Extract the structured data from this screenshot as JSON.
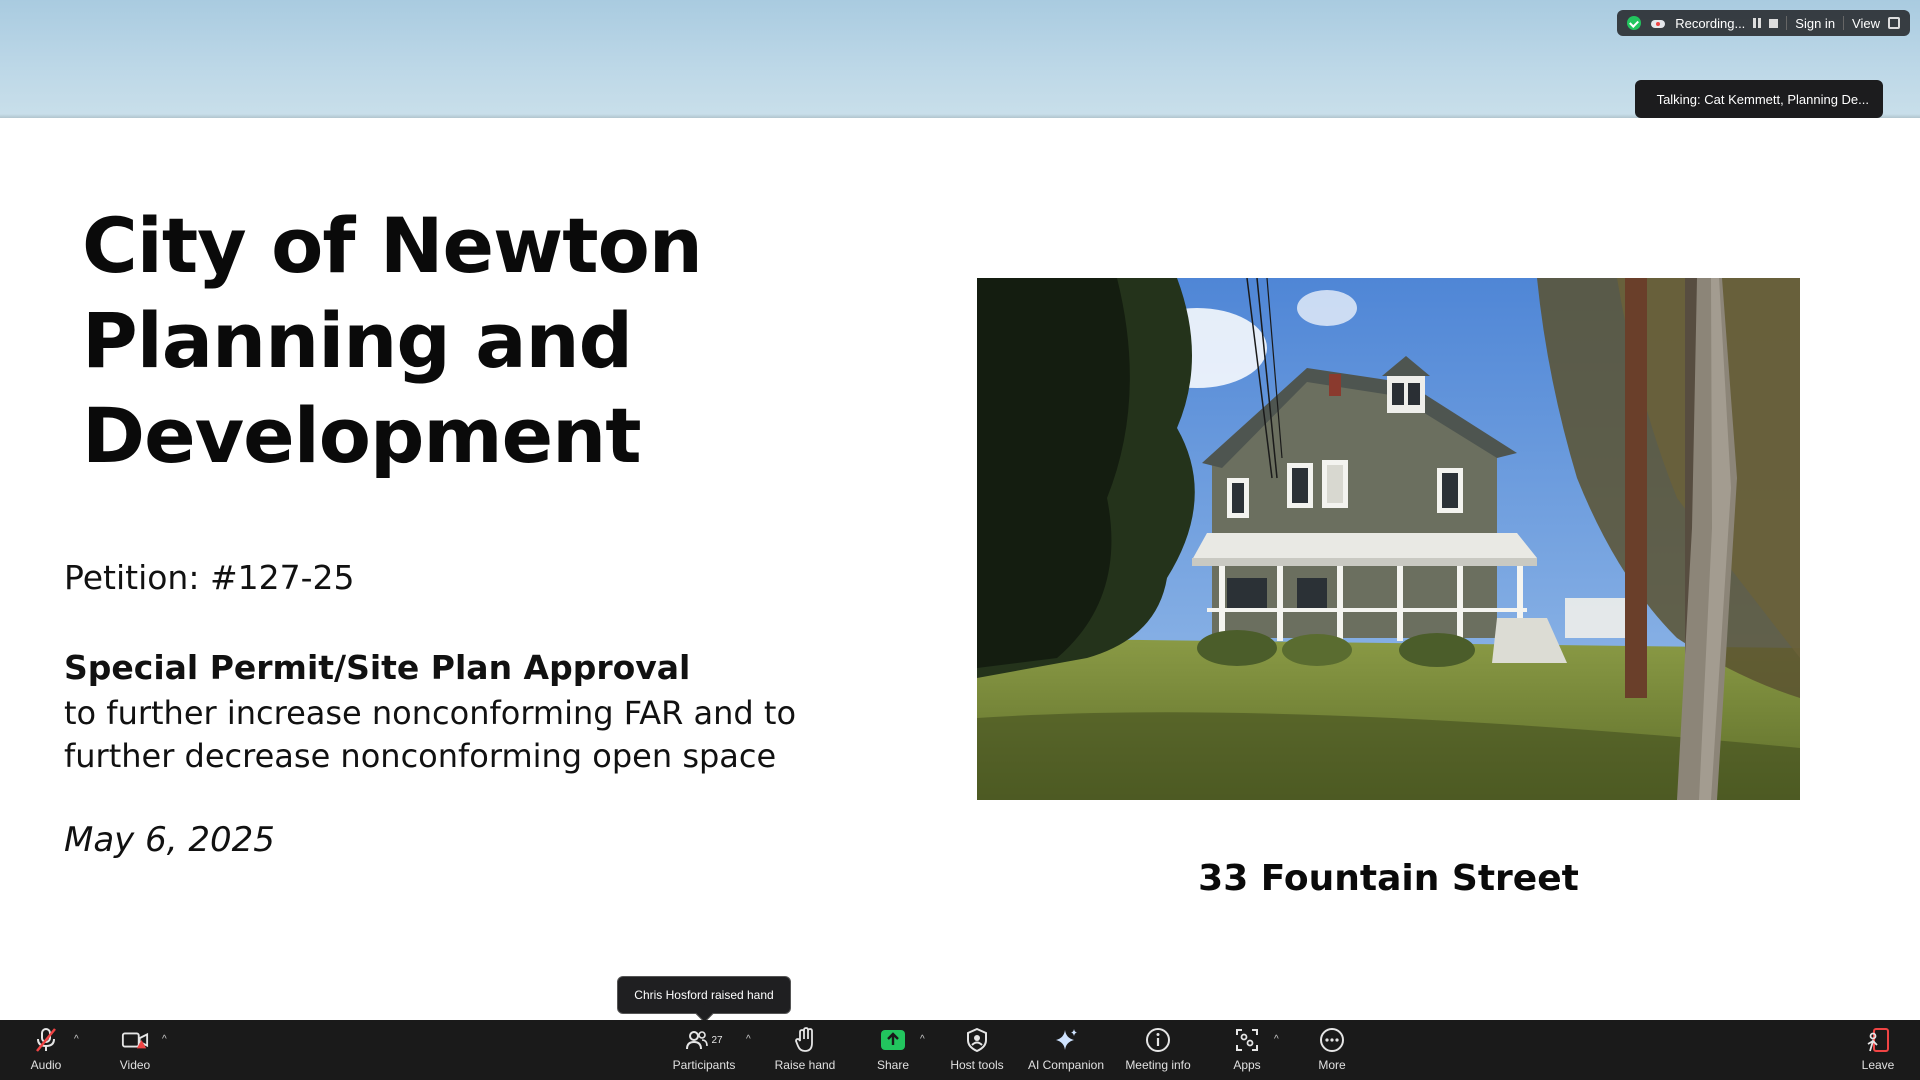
{
  "recording_bar": {
    "recording_label": "Recording...",
    "sign_in_label": "Sign in",
    "view_label": "View"
  },
  "talking_indicator": "Talking: Cat Kemmett, Planning De...",
  "slide": {
    "title_lines": [
      "City of Newton",
      "Planning and",
      "Development"
    ],
    "petition": "Petition: #127-25",
    "permit_heading": "Special Permit/Site Plan Approval",
    "permit_desc_lines": [
      "to further increase nonconforming FAR and to",
      "further decrease nonconforming open space"
    ],
    "date": "May 6, 2025",
    "address": "33 Fountain Street"
  },
  "raised_hand_toast": "Chris Hosford raised hand",
  "toolbar": {
    "audio": "Audio",
    "video": "Video",
    "participants": "Participants",
    "participants_count": "27",
    "raise_hand": "Raise hand",
    "share": "Share",
    "host_tools": "Host tools",
    "ai_companion": "AI Companion",
    "meeting_info": "Meeting info",
    "apps": "Apps",
    "more": "More",
    "leave": "Leave"
  },
  "colors": {
    "share_green": "#22c55e",
    "leave_red": "#ef4444",
    "toolbar_bg": "#1a1a1a"
  }
}
